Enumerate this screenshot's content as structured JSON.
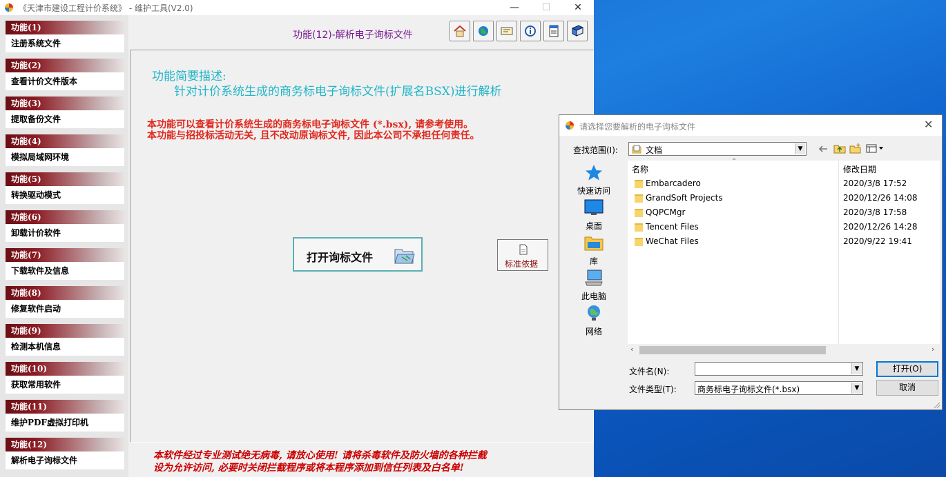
{
  "main_window": {
    "title": "《天津市建设工程计价系统》 - 维护工具(V2.0)",
    "controls": {
      "minimize": "—",
      "maximize": "☐",
      "close": "✕"
    }
  },
  "sidebar": {
    "items": [
      {
        "head": "功能(1)",
        "label": "注册系统文件"
      },
      {
        "head": "功能(2)",
        "label": "查看计价文件版本"
      },
      {
        "head": "功能(3)",
        "label": "提取备份文件"
      },
      {
        "head": "功能(4)",
        "label": "模拟局域网环境"
      },
      {
        "head": "功能(5)",
        "label": "转换驱动模式"
      },
      {
        "head": "功能(6)",
        "label": "卸载计价软件"
      },
      {
        "head": "功能(7)",
        "label": "下载软件及信息"
      },
      {
        "head": "功能(8)",
        "label": "修复软件启动"
      },
      {
        "head": "功能(9)",
        "label": "检测本机信息"
      },
      {
        "head": "功能(10)",
        "label": "获取常用软件"
      },
      {
        "head": "功能(11)",
        "label": "维护PDF虚拟打印机"
      },
      {
        "head": "功能(12)",
        "label": "解析电子询标文件"
      }
    ]
  },
  "header": {
    "function_title": "功能(12)-解析电子询标文件",
    "toolbar_icons": [
      "home-icon",
      "globe-icon",
      "card-icon",
      "info-icon",
      "document-icon",
      "book-icon"
    ]
  },
  "content": {
    "desc_title": "功能简要描述:",
    "desc_body": "针对计价系统生成的商务标电子询标文件(扩展名BSX)进行解析",
    "warning_1": "本功能可以查看计价系统生成的商务标电子询标文件 (*.bsx), 请参考使用。",
    "warning_2": "本功能与招投标活动无关, 且不改动原询标文件, 因此本公司不承担任何责任。",
    "open_button": "打开询标文件",
    "standard_button": "标准依据",
    "footer_1": "本软件经过专业测试绝无病毒, 请放心使用! 请将杀毒软件及防火墙的各种拦截",
    "footer_2": "设为允许访问, 必要时关闭拦截程序或将本程序添加到信任列表及白名单!"
  },
  "dialog": {
    "title": "请选择您要解析的电子询标文件",
    "look_in_label": "查找范围(I):",
    "look_in_value": "文档",
    "places": [
      "快速访问",
      "桌面",
      "库",
      "此电脑",
      "网络"
    ],
    "columns": {
      "name": "名称",
      "modified": "修改日期"
    },
    "files": [
      {
        "name": "Embarcadero",
        "date": "2020/3/8 17:52"
      },
      {
        "name": "GrandSoft Projects",
        "date": "2020/12/26 14:08"
      },
      {
        "name": "QQPCMgr",
        "date": "2020/3/8 17:58"
      },
      {
        "name": "Tencent Files",
        "date": "2020/12/26 14:28"
      },
      {
        "name": "WeChat Files",
        "date": "2020/9/22 19:41"
      }
    ],
    "filename_label": "文件名(N):",
    "filename_value": "",
    "filetype_label": "文件类型(T):",
    "filetype_value": "商务标电子询标文件(*.bsx)",
    "open_button": "打开(O)",
    "cancel_button": "取消"
  },
  "colors": {
    "sidebar_head": "#8b1a22",
    "function_title": "#7a1a90",
    "description": "#20b6c8",
    "warning": "#e0281c",
    "footer": "#cc0000",
    "desktop": "#1565c8"
  }
}
